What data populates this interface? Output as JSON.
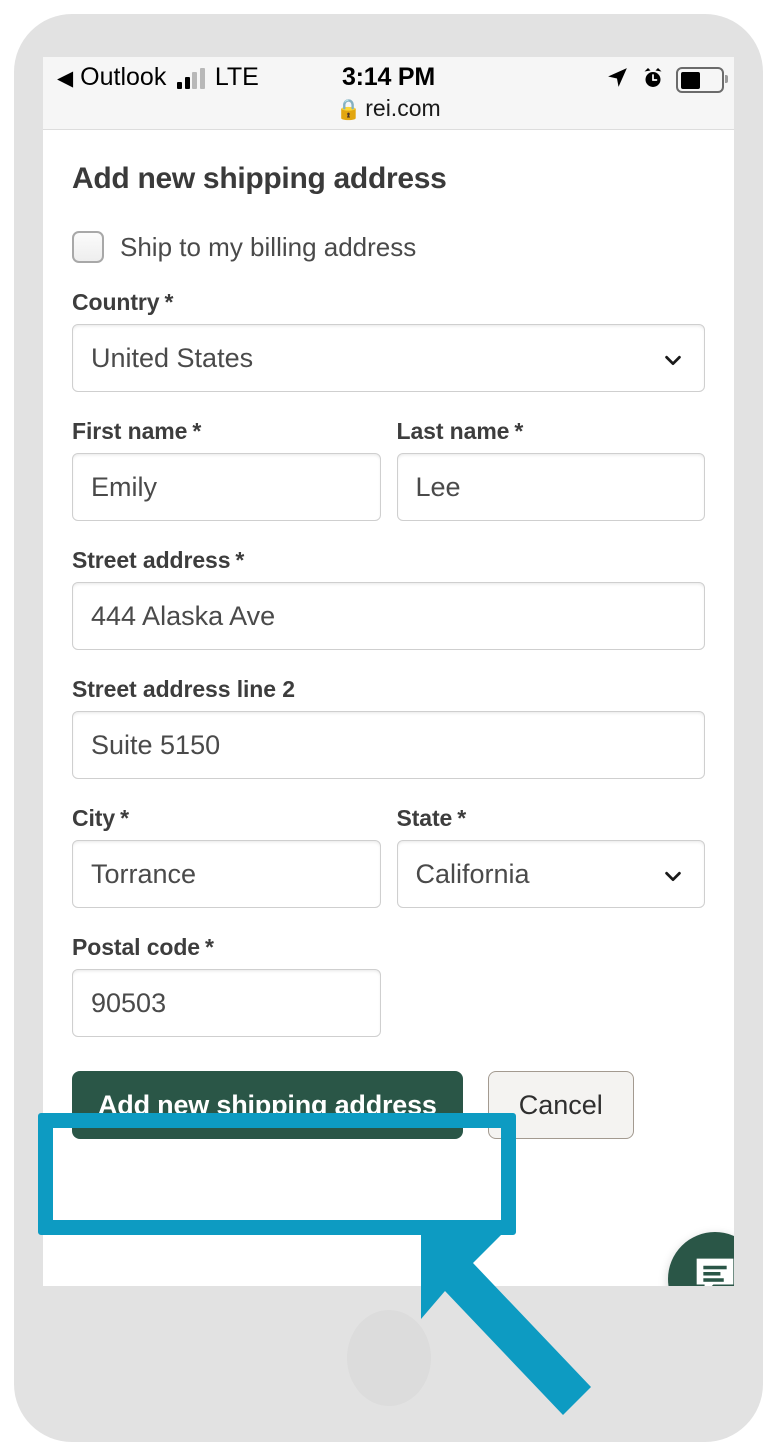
{
  "status_bar": {
    "back_app": "Outlook",
    "back_arrow": "◀",
    "network": "LTE",
    "time": "3:14 PM",
    "lock_icon": "🔒",
    "url": "rei.com"
  },
  "page": {
    "title": "Add new shipping address"
  },
  "checkbox": {
    "label": "Ship to my billing address",
    "checked": false
  },
  "fields": [
    {
      "id": "country",
      "label": "Country",
      "required": true,
      "required_mark": "*",
      "value": "United States",
      "type": "select"
    },
    {
      "id": "first_name",
      "label": "First name",
      "required": true,
      "required_mark": "*",
      "value": "Emily",
      "type": "text"
    },
    {
      "id": "last_name",
      "label": "Last name",
      "required": true,
      "required_mark": "*",
      "value": "Lee",
      "type": "text"
    },
    {
      "id": "street_address",
      "label": "Street address",
      "required": true,
      "required_mark": "*",
      "value": "444 Alaska Ave",
      "type": "text"
    },
    {
      "id": "street_address_2",
      "label": "Street address line 2",
      "required": false,
      "required_mark": "",
      "value": "Suite 5150",
      "type": "text"
    },
    {
      "id": "city",
      "label": "City",
      "required": true,
      "required_mark": "*",
      "value": "Torrance",
      "type": "text"
    },
    {
      "id": "state",
      "label": "State",
      "required": true,
      "required_mark": "*",
      "value": "California",
      "type": "select"
    },
    {
      "id": "postal_code",
      "label": "Postal code",
      "required": true,
      "required_mark": "*",
      "value": "90503",
      "type": "text"
    }
  ],
  "actions": {
    "submit_label": "Add new shipping address",
    "cancel_label": "Cancel"
  },
  "chat": {
    "icon": "chat-bubble-icon"
  },
  "annotation": {
    "highlight_color": "#0d9bc2",
    "arrow_color": "#0d9bc2",
    "target": "Add new shipping address"
  },
  "colors": {
    "primary_green": "#2a5647",
    "accent_cyan": "#0d9bc2",
    "frame_gray": "#e2e2e2",
    "status_bar_bg": "#f6f6f6",
    "input_border": "#cfcfcf",
    "cancel_bg": "#f4f3f1"
  }
}
